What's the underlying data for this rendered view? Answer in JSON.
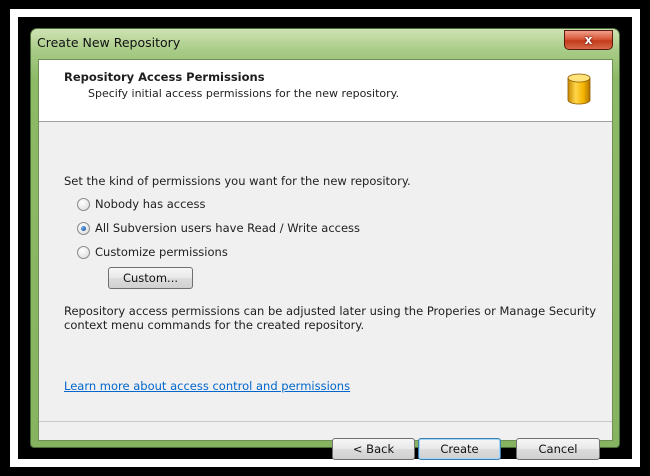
{
  "window": {
    "title": "Create New Repository",
    "close_glyph": "x"
  },
  "header": {
    "title": "Repository Access Permissions",
    "subtitle": "Specify initial access permissions for the new repository.",
    "icon": "database-icon"
  },
  "body": {
    "prompt": "Set the kind of permissions you want for the new repository.",
    "options": [
      {
        "label": "Nobody has access",
        "checked": false
      },
      {
        "label": "All Subversion users have Read / Write access",
        "checked": true
      },
      {
        "label": "Customize permissions",
        "checked": false
      }
    ],
    "custom_button": "Custom...",
    "note_line1": "Repository access permissions can be adjusted later using the Properies or Manage Security",
    "note_line2": "context menu commands for the created repository.",
    "link": "Learn more about access control and permissions"
  },
  "footer": {
    "back": "< Back",
    "create": "Create",
    "cancel": "Cancel"
  }
}
